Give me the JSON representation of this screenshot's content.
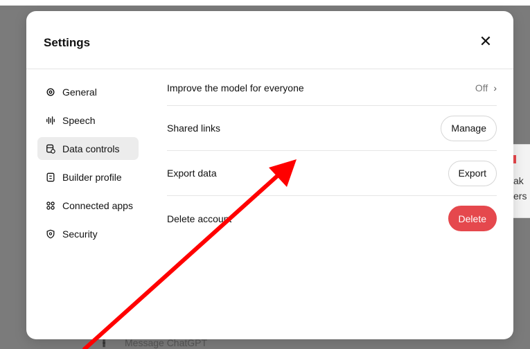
{
  "background": {
    "fragment_1": "ak",
    "fragment_2": "ers",
    "composer_placeholder": "Message ChatGPT"
  },
  "modal": {
    "title": "Settings",
    "close_icon": "close-icon"
  },
  "sidebar": {
    "items": [
      {
        "label": "General",
        "icon": "gear-icon",
        "active": false
      },
      {
        "label": "Speech",
        "icon": "waveform-icon",
        "active": false
      },
      {
        "label": "Data controls",
        "icon": "database-icon",
        "active": true
      },
      {
        "label": "Builder profile",
        "icon": "id-card-icon",
        "active": false
      },
      {
        "label": "Connected apps",
        "icon": "grid-icon",
        "active": false
      },
      {
        "label": "Security",
        "icon": "shield-icon",
        "active": false
      }
    ]
  },
  "data_controls": {
    "improve_model": {
      "label": "Improve the model for everyone",
      "value": "Off"
    },
    "shared_links": {
      "label": "Shared links",
      "button": "Manage"
    },
    "export_data": {
      "label": "Export data",
      "button": "Export"
    },
    "delete_account": {
      "label": "Delete account",
      "button": "Delete"
    }
  },
  "colors": {
    "danger": "#e5484d",
    "annotation_arrow": "#ff0000",
    "overlay": "#7b7b7b"
  }
}
